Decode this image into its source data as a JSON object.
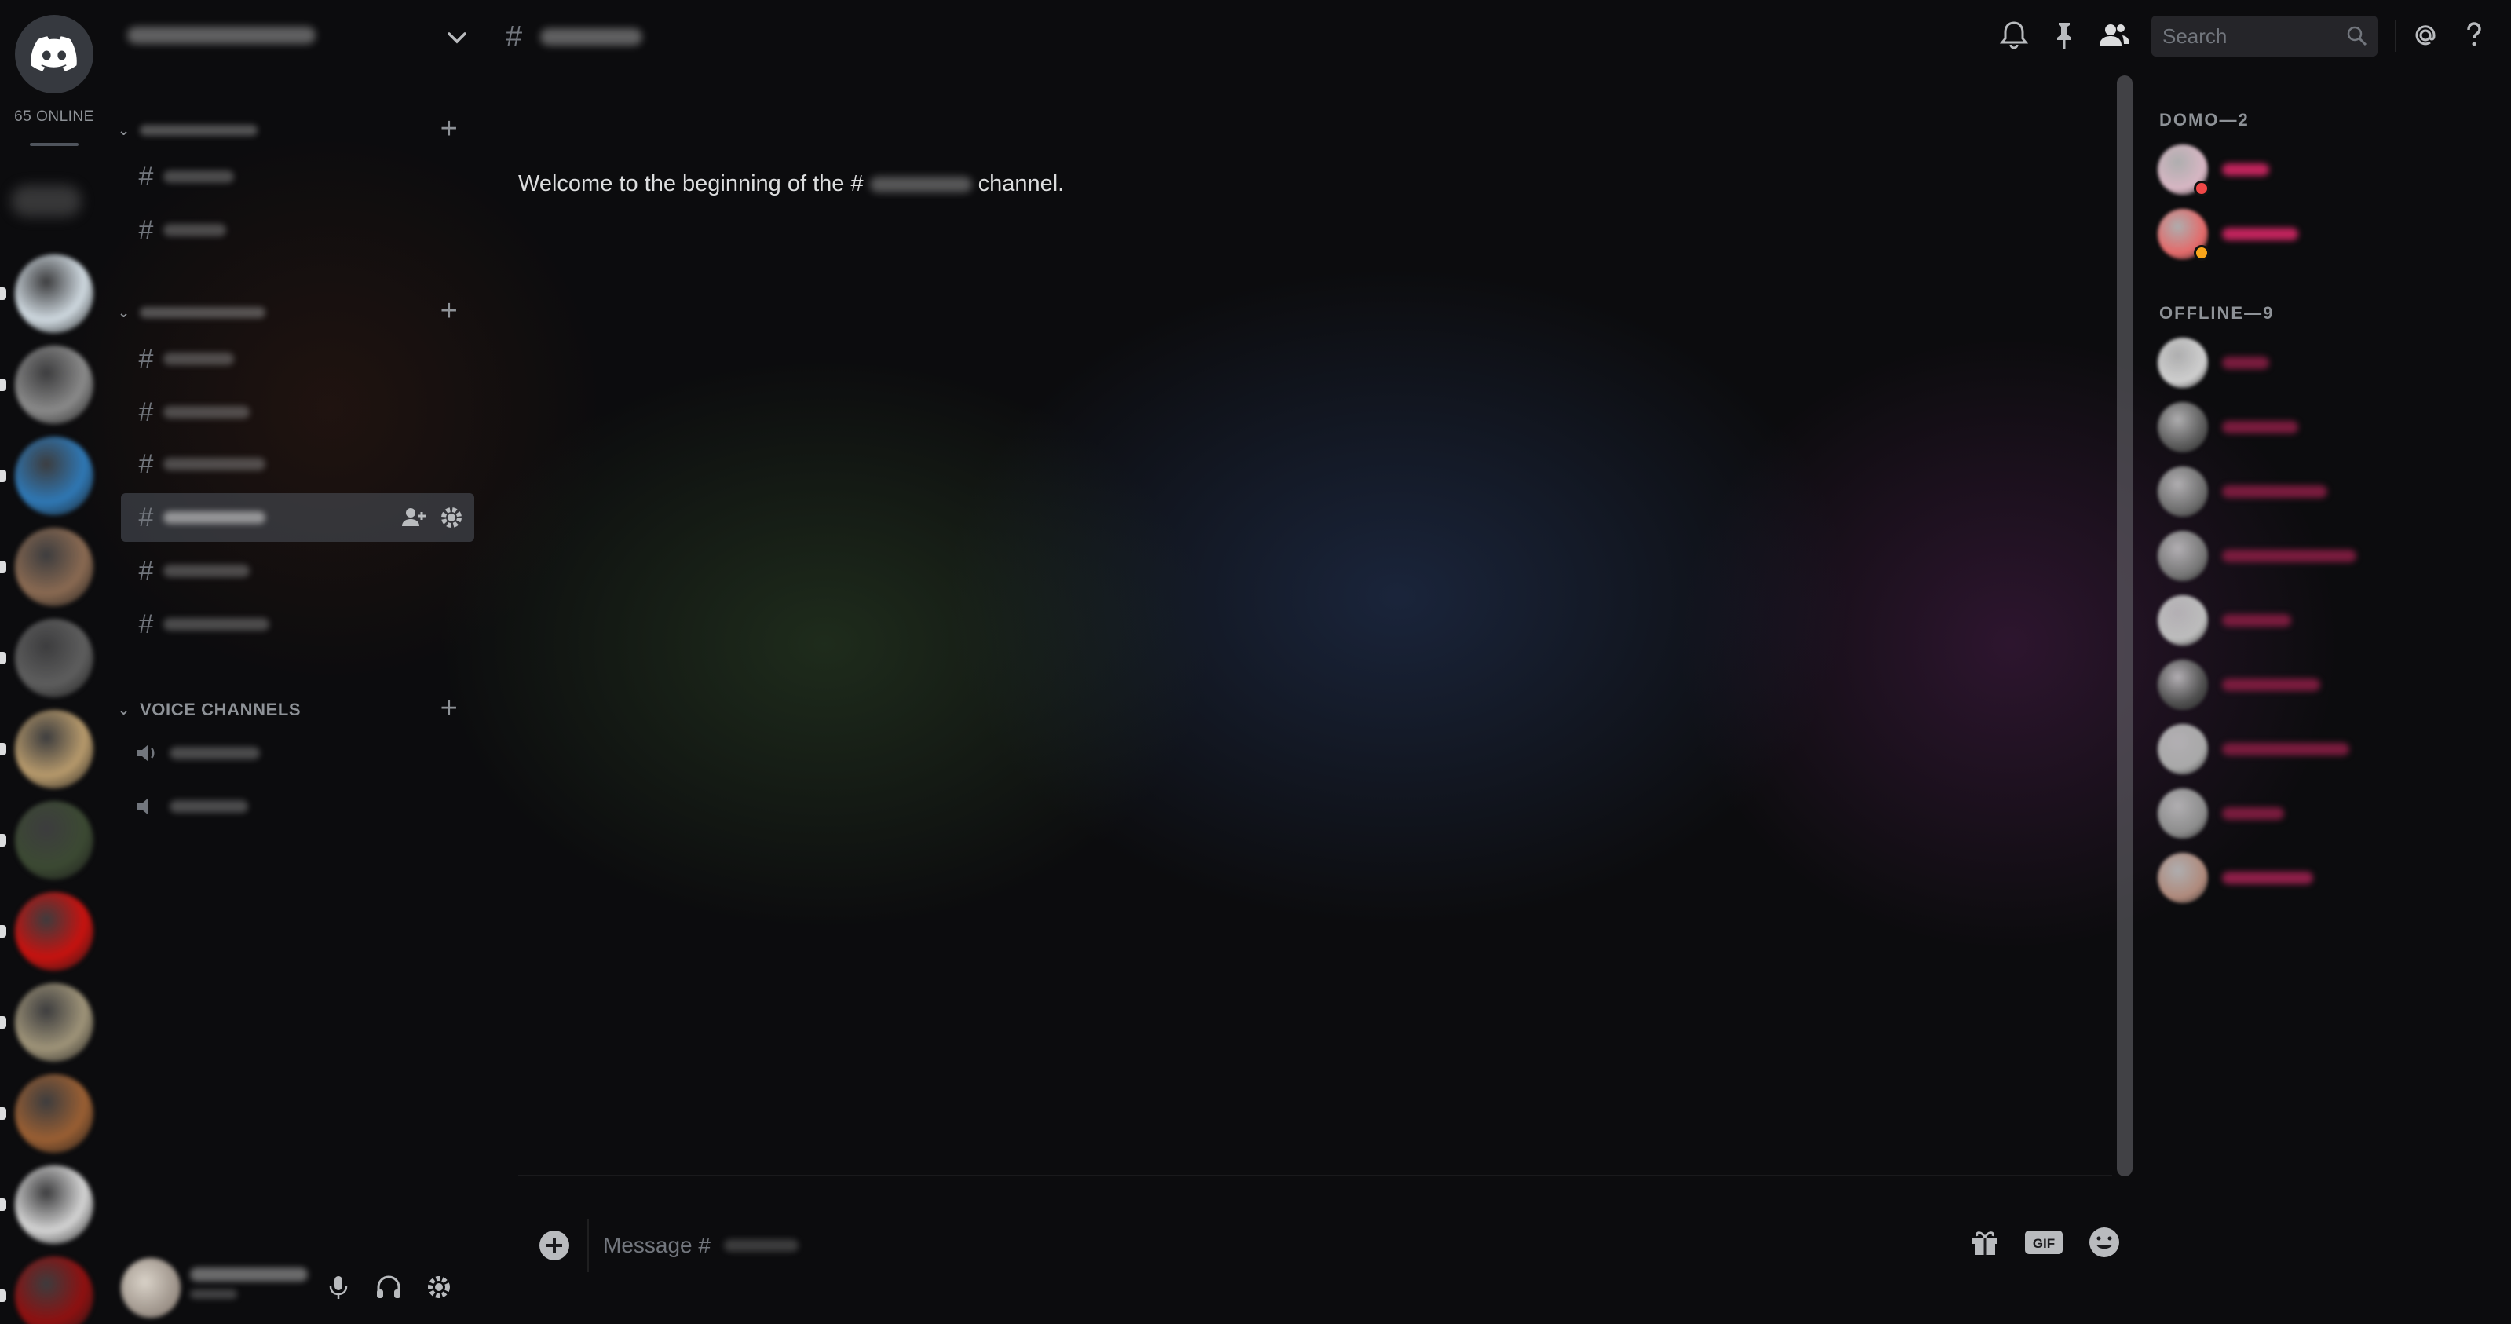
{
  "server_rail": {
    "online_label": "65 ONLINE",
    "servers": [
      {
        "color": "#cfd9e0"
      },
      {
        "color": "#8a8a8a"
      },
      {
        "color": "#2f78b5"
      },
      {
        "color": "#8a6a52"
      },
      {
        "color": "#5e5e5e"
      },
      {
        "color": "#b79a6c"
      },
      {
        "color": "#3c4a33"
      },
      {
        "color": "#c8120f"
      },
      {
        "color": "#9f9479"
      },
      {
        "color": "#9a5f33"
      },
      {
        "color": "#d4d4d4"
      },
      {
        "color": "#8f1010"
      }
    ]
  },
  "channel_sidebar": {
    "voice_category_label": "VOICE CHANNELS",
    "categories": [
      {
        "kind": "text",
        "channels": [
          {
            "icon": "hash-icon"
          },
          {
            "icon": "hash-icon"
          }
        ]
      },
      {
        "kind": "text-locked",
        "channels": [
          {
            "icon": "locked-hash-icon"
          },
          {
            "icon": "locked-hash-icon"
          },
          {
            "icon": "locked-hash-icon"
          },
          {
            "icon": "locked-hash-icon",
            "active": true
          },
          {
            "icon": "locked-hash-icon"
          },
          {
            "icon": "locked-hash-icon"
          }
        ]
      },
      {
        "kind": "voice",
        "channels": [
          {
            "icon": "speaker-icon"
          },
          {
            "icon": "locked-speaker-icon"
          }
        ]
      }
    ]
  },
  "chat": {
    "welcome_prefix": "Welcome to the beginning of the #",
    "welcome_suffix": "channel.",
    "composer_placeholder": "Message #"
  },
  "toolbar": {
    "search_placeholder": "Search",
    "icons": [
      "bell-icon",
      "pin-icon",
      "members-icon",
      "at-icon",
      "help-icon"
    ]
  },
  "members": {
    "groups": [
      {
        "label": "DOMO—2",
        "members": [
          {
            "avatar_color": "#d8b7c4",
            "status_color": "#f04747",
            "name_color": "#c0245c"
          },
          {
            "avatar_color": "#e56a6a",
            "status_color": "#faa61a",
            "name_color": "#c0245c"
          }
        ]
      },
      {
        "label": "OFFLINE—9",
        "members": [
          {
            "avatar_color": "#cfcfcf",
            "name_color": "#7a1c3e"
          },
          {
            "avatar_color": "#5a5a5a",
            "name_color": "#7a1c3e"
          },
          {
            "avatar_color": "#6e6e6e",
            "name_color": "#7a1c3e"
          },
          {
            "avatar_color": "#777777",
            "name_color": "#7a1c3e"
          },
          {
            "avatar_color": "#bdbdbd",
            "name_color": "#7a1c3e"
          },
          {
            "avatar_color": "#4e4e4e",
            "name_color": "#7a1c3e"
          },
          {
            "avatar_color": "#a9a9a9",
            "name_color": "#7a1c3e"
          },
          {
            "avatar_color": "#8d8d8d",
            "name_color": "#7a1c3e"
          },
          {
            "avatar_color": "#b08a7c",
            "name_color": "#8e1f49"
          }
        ]
      }
    ]
  },
  "colors": {
    "accent": "#7289da",
    "text_muted": "#8e9297",
    "text_normal": "#dcddde"
  }
}
